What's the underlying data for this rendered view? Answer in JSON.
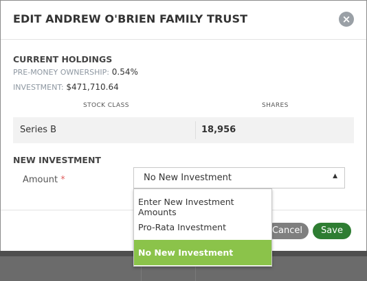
{
  "modal": {
    "title": "EDIT ANDREW O'BRIEN FAMILY TRUST",
    "close_icon": "close-icon"
  },
  "current_holdings": {
    "heading": "CURRENT HOLDINGS",
    "pre_money_label": "PRE-MONEY OWNERSHIP:",
    "pre_money_value": "0.54%",
    "investment_label": "INVESTMENT:",
    "investment_value": "$471,710.64",
    "columns": [
      "STOCK CLASS",
      "SHARES"
    ],
    "rows": [
      {
        "stock_class": "Series B",
        "shares": "18,956"
      }
    ]
  },
  "new_investment": {
    "heading": "NEW INVESTMENT",
    "amount_label": "Amount",
    "required_mark": "*",
    "selected_value": "No New Investment",
    "options": [
      "Enter New Investment Amounts",
      "Pro-Rata Investment",
      "No New Investment"
    ]
  },
  "footer": {
    "cancel_label": "Cancel",
    "save_label": "Save"
  },
  "colors": {
    "selected_option": "#8bc34a",
    "save_button": "#2e7d32",
    "cancel_button": "#7f7f7f"
  }
}
